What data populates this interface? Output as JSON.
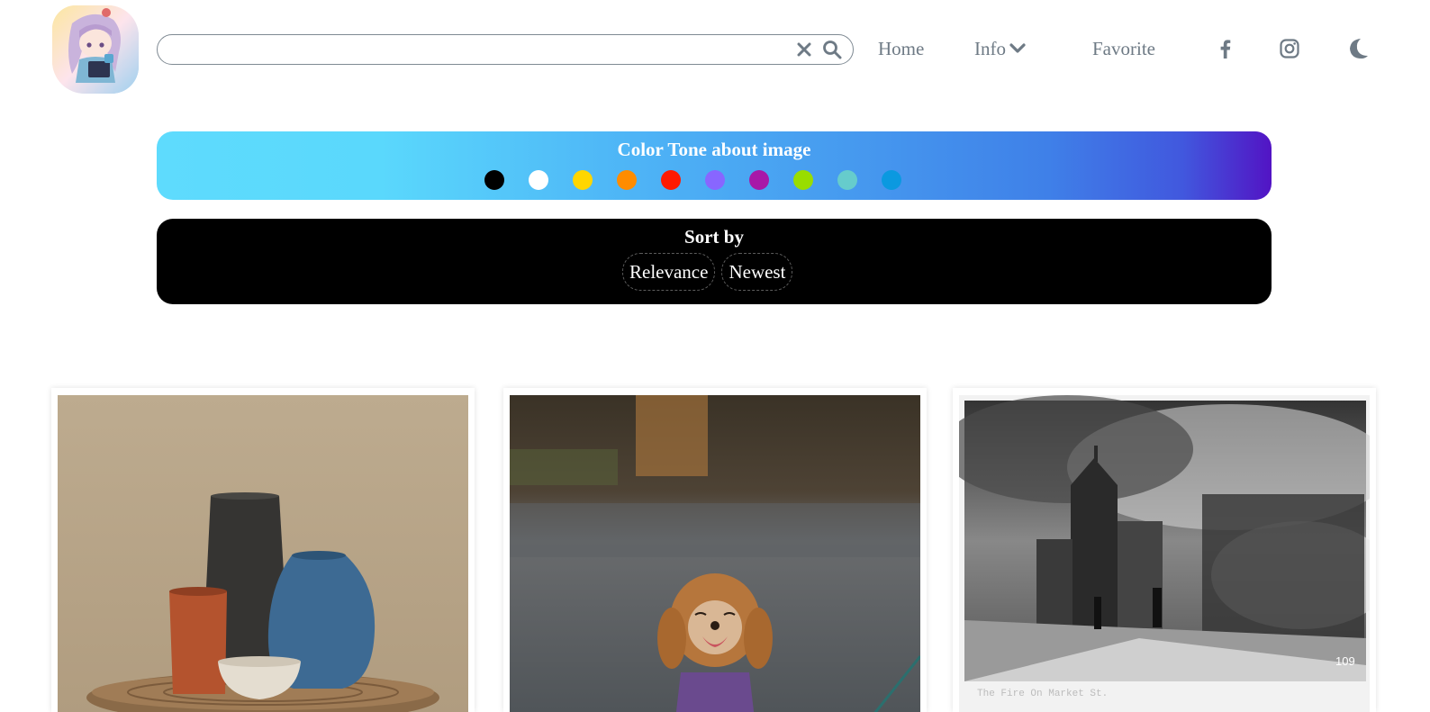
{
  "header": {
    "logo_icon": "anime-girl-reading-avatar",
    "search": {
      "value": "",
      "placeholder": ""
    },
    "nav": {
      "home": "Home",
      "info": "Info",
      "favorite": "Favorite"
    },
    "icons": [
      "clear-icon",
      "search-icon",
      "chevron-down-icon",
      "facebook-icon",
      "instagram-icon",
      "moon-icon"
    ]
  },
  "color_tone": {
    "title": "Color Tone about image",
    "swatches": [
      {
        "name": "black",
        "color": "#000000"
      },
      {
        "name": "white",
        "color": "#ffffff"
      },
      {
        "name": "yellow",
        "color": "#ffd600"
      },
      {
        "name": "orange",
        "color": "#ff8c00"
      },
      {
        "name": "red",
        "color": "#ff1a00"
      },
      {
        "name": "purple",
        "color": "#8866ff"
      },
      {
        "name": "magenta",
        "color": "#a818a8"
      },
      {
        "name": "green",
        "color": "#99dd00"
      },
      {
        "name": "teal",
        "color": "#66cccc"
      },
      {
        "name": "blue",
        "color": "#0b99e0"
      }
    ],
    "gradient_start": "#5edbfd",
    "gradient_end": "#5214c4"
  },
  "sort": {
    "title": "Sort by",
    "options": [
      "Relevance",
      "Newest"
    ]
  },
  "gallery": {
    "images": [
      {
        "subject": "ceramic-vases-still-life"
      },
      {
        "subject": "poodle-puppy-on-leash"
      },
      {
        "subject": "historic-city-fire-photograph",
        "caption": "The Fire On Market St.",
        "number": "109"
      }
    ]
  }
}
